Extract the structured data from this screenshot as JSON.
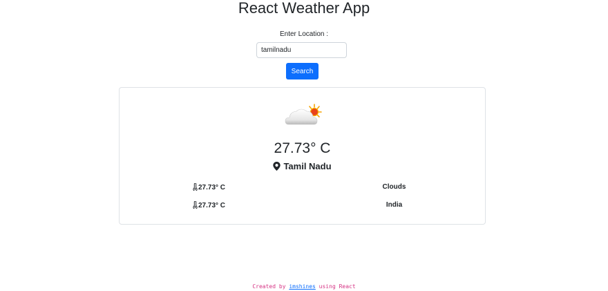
{
  "app": {
    "title": "React Weather App"
  },
  "search": {
    "label": "Enter Location :",
    "value": "tamilnadu",
    "button_label": "Search"
  },
  "weather": {
    "icon": "cloud-sun-icon",
    "temperature": "27.73° C",
    "location": "Tamil Nadu",
    "details": [
      {
        "left": "27.73° C",
        "right": "Clouds"
      },
      {
        "left": "27.73° C",
        "right": "India"
      }
    ]
  },
  "footer": {
    "prefix": "Created by ",
    "author": "imshines",
    "suffix": " using React"
  },
  "colors": {
    "primary": "#0d6efd",
    "footer_text": "#d63384",
    "border": "#dee2e6"
  }
}
